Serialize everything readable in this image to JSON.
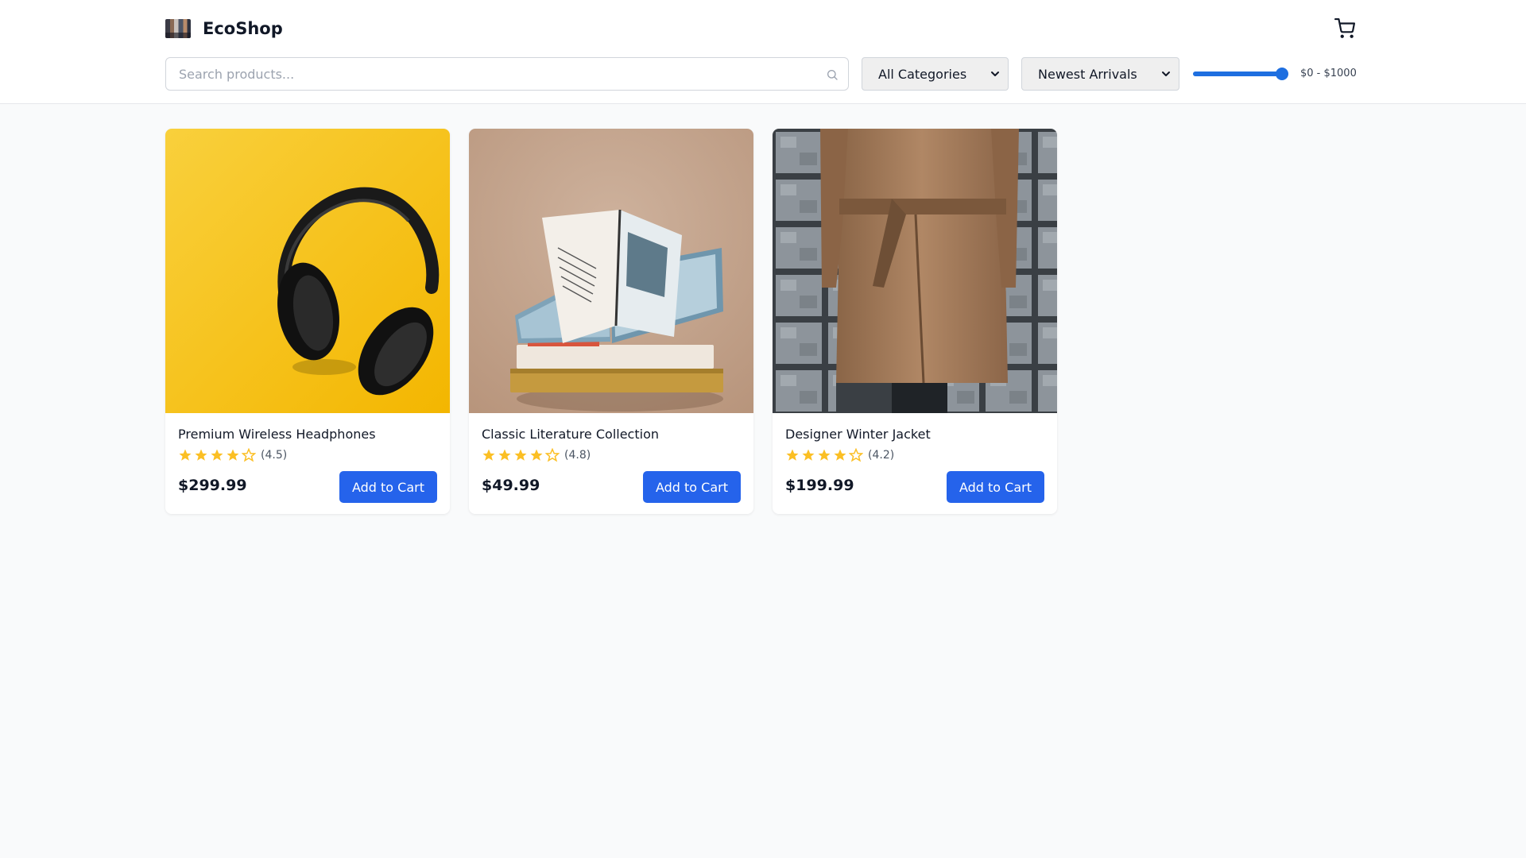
{
  "app": {
    "title": "EcoShop",
    "logo_icon": "store-logo-icon",
    "cart_icon": "shopping-cart-icon"
  },
  "filters": {
    "search_placeholder": "Search products...",
    "search_value": "",
    "search_icon": "search-icon",
    "category_selected": "All Categories",
    "sort_selected": "Newest Arrivals",
    "price_range_label": "$0 - $1000",
    "price_min": 0,
    "price_max": 1000,
    "price_value": 1000
  },
  "products": [
    {
      "title": "Premium Wireless Headphones",
      "rating": 4.5,
      "rating_label": "(4.5)",
      "price": "$299.99",
      "button_label": "Add to Cart",
      "image": "headphones-photo"
    },
    {
      "title": "Classic Literature Collection",
      "rating": 4.8,
      "rating_label": "(4.8)",
      "price": "$49.99",
      "button_label": "Add to Cart",
      "image": "books-photo"
    },
    {
      "title": "Designer Winter Jacket",
      "rating": 4.2,
      "rating_label": "(4.2)",
      "price": "$199.99",
      "button_label": "Add to Cart",
      "image": "coat-photo"
    }
  ],
  "colors": {
    "accent": "#2563eb",
    "star": "#fbbf24",
    "background": "#f9fafb"
  }
}
